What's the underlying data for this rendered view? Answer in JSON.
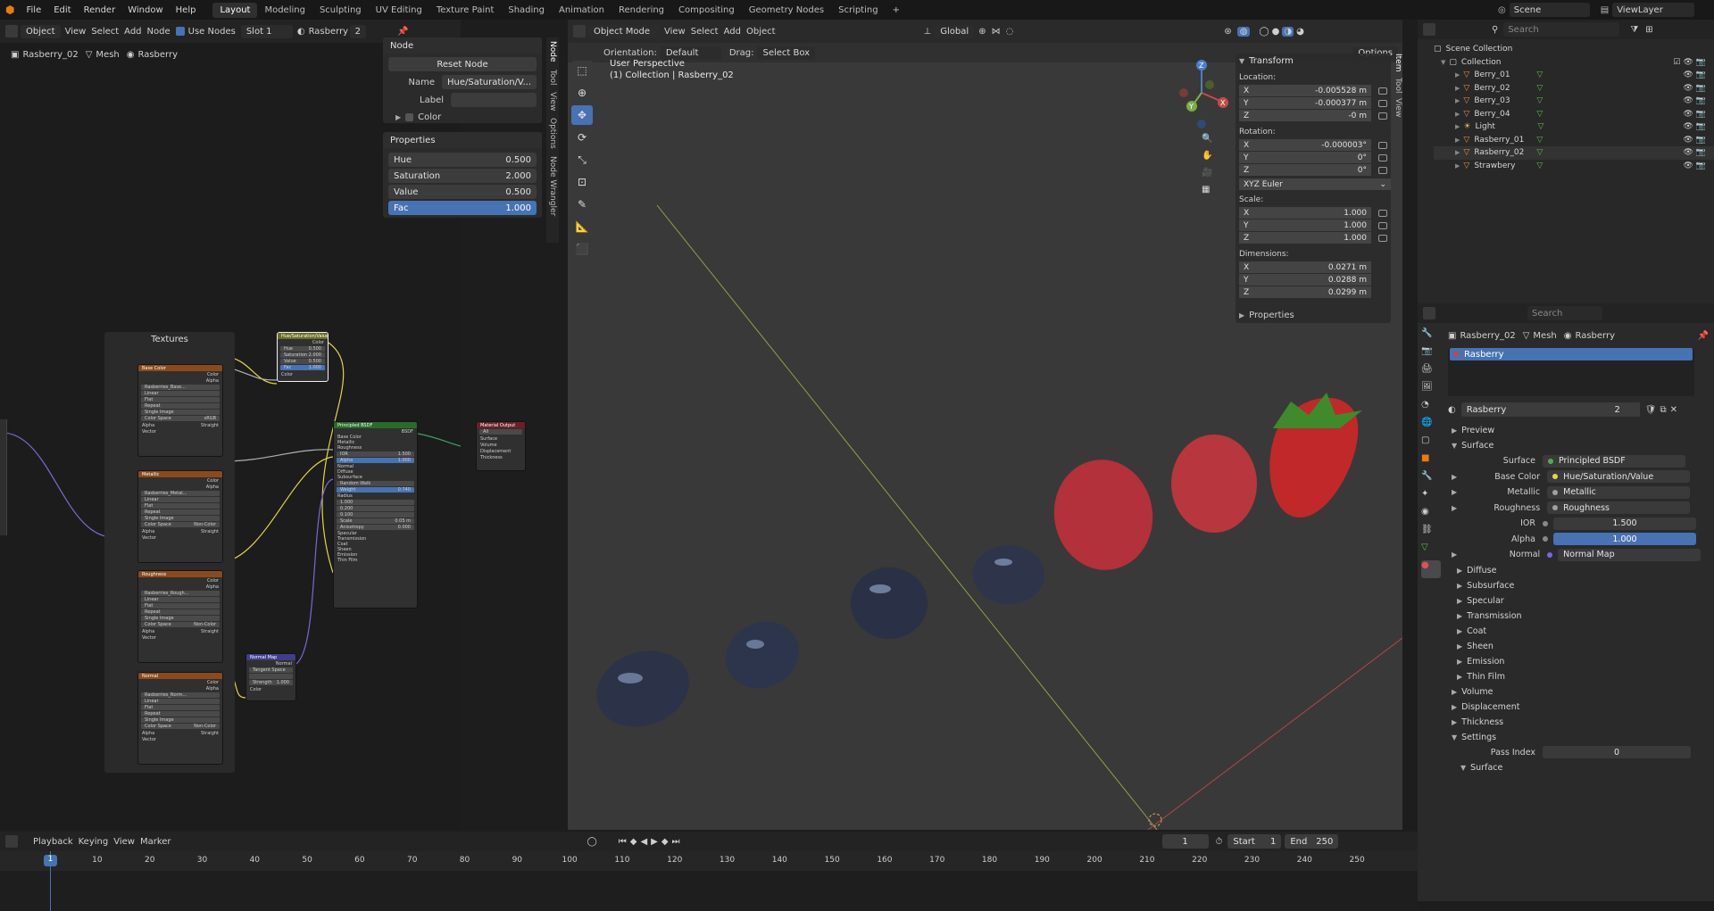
{
  "topbar": {
    "menus": [
      "File",
      "Edit",
      "Render",
      "Window",
      "Help"
    ],
    "workspaces": [
      "Layout",
      "Modeling",
      "Sculpting",
      "UV Editing",
      "Texture Paint",
      "Shading",
      "Animation",
      "Rendering",
      "Compositing",
      "Geometry Nodes",
      "Scripting",
      "+"
    ],
    "active_workspace": "Layout",
    "scene": "Scene",
    "view_layer": "ViewLayer"
  },
  "node_editor": {
    "header": {
      "mode": "Object",
      "view": "View",
      "select": "Select",
      "add": "Add",
      "node": "Node",
      "use_nodes": "Use Nodes",
      "slot": "Slot 1",
      "material": "Rasberry",
      "users": "2"
    },
    "breadcrumb": [
      "Rasberry_02",
      "Mesh",
      "Rasberry"
    ],
    "frame_label": "Textures",
    "side_tabs": [
      "Node",
      "Tool",
      "View",
      "Options",
      "Node Wrangler"
    ],
    "node_panel": {
      "title": "Node",
      "reset": "Reset Node",
      "name_label": "Name",
      "name_value": "Hue/Saturation/V...",
      "label_label": "Label",
      "color_label": "Color"
    },
    "properties_panel": {
      "title": "Properties",
      "rows": [
        {
          "label": "Hue",
          "value": "0.500"
        },
        {
          "label": "Saturation",
          "value": "2.000"
        },
        {
          "label": "Value",
          "value": "0.500"
        },
        {
          "label": "Fac",
          "value": "1.000"
        }
      ]
    },
    "nodes": {
      "base_color": {
        "title": "Base Color",
        "image": "Rasberries_Base...",
        "rows": [
          "Linear",
          "Flat",
          "Repeat",
          "Single Image"
        ],
        "cs_label": "Color Space",
        "cs_value": "sRGB",
        "alpha_label": "Alpha",
        "alpha_value": "Straight",
        "out1": "Color",
        "out2": "Alpha",
        "vec": "Vector"
      },
      "metallic": {
        "title": "Metallic",
        "image": "Rasberries_Metal...",
        "rows": [
          "Linear",
          "Flat",
          "Repeat",
          "Single Image"
        ],
        "cs_label": "Color Space",
        "cs_value": "Non-Color",
        "alpha_label": "Alpha",
        "alpha_value": "Straight",
        "out1": "Color",
        "out2": "Alpha",
        "vec": "Vector"
      },
      "roughness": {
        "title": "Roughness",
        "image": "Rasberries_Rough...",
        "rows": [
          "Linear",
          "Flat",
          "Repeat",
          "Single Image"
        ],
        "cs_label": "Color Space",
        "cs_value": "Non-Color",
        "alpha_label": "Alpha",
        "alpha_value": "Straight",
        "out1": "Color",
        "out2": "Alpha",
        "vec": "Vector"
      },
      "normal": {
        "title": "Normal",
        "image": "Rasberries_Norm...",
        "rows": [
          "Linear",
          "Flat",
          "Repeat",
          "Single Image"
        ],
        "cs_label": "Color Space",
        "cs_value": "Non-Color",
        "alpha_label": "Alpha",
        "alpha_value": "Straight",
        "out1": "Color",
        "out2": "Alpha",
        "vec": "Vector"
      },
      "hsv": {
        "title": "Hue/Saturation/Value",
        "rows": [
          {
            "l": "Hue",
            "v": "0.500"
          },
          {
            "l": "Saturation",
            "v": "2.000"
          },
          {
            "l": "Value",
            "v": "0.500"
          },
          {
            "l": "Fac",
            "v": "1.000"
          }
        ],
        "out": "Color",
        "inp": "Color"
      },
      "normal_map": {
        "title": "Normal Map",
        "out": "Normal",
        "space": "Tangent Space",
        "strength_label": "Strength",
        "strength": "1.000",
        "inp": "Color"
      },
      "bsdf": {
        "title": "Principled BSDF",
        "out": "BSDF",
        "rows": [
          "Base Color",
          "Metallic",
          "Roughness",
          "IOR",
          "Alpha",
          "Normal",
          "Diffuse",
          "Subsurface",
          "Random Walk",
          "Weight",
          "Radius",
          "1.000",
          "0.200",
          "0.100",
          "Scale",
          "Anisotropy",
          "Specular",
          "Transmission",
          "Coat",
          "Sheen",
          "Emission",
          "Thin Film"
        ],
        "ior": "1.500",
        "alpha": "1.000",
        "weight": "0.740",
        "scale": "0.05 m",
        "aniso": "0.000"
      },
      "output": {
        "title": "Material Output",
        "target": "All",
        "rows": [
          "Surface",
          "Volume",
          "Displacement",
          "Thickness"
        ]
      }
    }
  },
  "viewport": {
    "header": {
      "mode": "Object Mode",
      "view": "View",
      "select": "Select",
      "add": "Add",
      "object": "Object",
      "transform": "Global"
    },
    "sub": {
      "orientation_label": "Orientation:",
      "orientation": "Default",
      "drag_label": "Drag:",
      "drag": "Select Box",
      "options": "Options"
    },
    "overlay_title": "User Perspective",
    "overlay_sub": "(1) Collection | Rasberry_02",
    "side_tabs": [
      "Item",
      "Tool",
      "View"
    ],
    "transform": {
      "title": "Transform",
      "location_label": "Location:",
      "location": [
        {
          "a": "X",
          "v": "-0.005528 m"
        },
        {
          "a": "Y",
          "v": "-0.000377 m"
        },
        {
          "a": "Z",
          "v": "-0 m"
        }
      ],
      "rotation_label": "Rotation:",
      "rotation": [
        {
          "a": "X",
          "v": "-0.000003°"
        },
        {
          "a": "Y",
          "v": "0°"
        },
        {
          "a": "Z",
          "v": "0°"
        }
      ],
      "rotation_mode": "XYZ Euler",
      "scale_label": "Scale:",
      "scale": [
        {
          "a": "X",
          "v": "1.000"
        },
        {
          "a": "Y",
          "v": "1.000"
        },
        {
          "a": "Z",
          "v": "1.000"
        }
      ],
      "dimensions_label": "Dimensions:",
      "dimensions": [
        {
          "a": "X",
          "v": "0.0271 m"
        },
        {
          "a": "Y",
          "v": "0.0288 m"
        },
        {
          "a": "Z",
          "v": "0.0299 m"
        }
      ],
      "properties": "Properties"
    },
    "gizmo": {
      "x": "X",
      "y": "Y",
      "z": "Z"
    }
  },
  "outliner": {
    "search_placeholder": "Search",
    "root": "Scene Collection",
    "collection": "Collection",
    "items": [
      "Berry_01",
      "Berry_02",
      "Berry_03",
      "Berry_04",
      "Light",
      "Rasberry_01",
      "Rasberry_02",
      "Strawbery"
    ]
  },
  "properties": {
    "search_placeholder": "Search",
    "breadcrumb": [
      "Rasberry_02",
      "Mesh",
      "Rasberry"
    ],
    "material_slot": "Rasberry",
    "material_name": "Rasberry",
    "users": "2",
    "preview": "Preview",
    "surface_section": "Surface",
    "rows": [
      {
        "label": "Surface",
        "value": "Principled BSDF",
        "dot": "#4caf50"
      },
      {
        "label": "Base Color",
        "value": "Hue/Saturation/Value",
        "dot": "#e5d34a"
      },
      {
        "label": "Metallic",
        "value": "Metallic",
        "dot": "#a0a0a0"
      },
      {
        "label": "Roughness",
        "value": "Roughness",
        "dot": "#a0a0a0"
      }
    ],
    "ior_label": "IOR",
    "ior": "1.500",
    "alpha_label": "Alpha",
    "alpha": "1.000",
    "normal_label": "Normal",
    "normal": "Normal Map",
    "sub_sections": [
      "Diffuse",
      "Subsurface",
      "Specular",
      "Transmission",
      "Coat",
      "Sheen",
      "Emission",
      "Thin Film"
    ],
    "volume": "Volume",
    "displacement": "Displacement",
    "thickness": "Thickness",
    "settings": "Settings",
    "pass_index_label": "Pass Index",
    "pass_index": "0",
    "settings_surface": "Surface"
  },
  "timeline": {
    "menus": [
      "Playback",
      "Keying",
      "View",
      "Marker"
    ],
    "current_frame": "1",
    "start_label": "Start",
    "start": "1",
    "end_label": "End",
    "end": "250",
    "ticks": [
      "1",
      "10",
      "20",
      "30",
      "40",
      "50",
      "60",
      "70",
      "80",
      "90",
      "100",
      "110",
      "120",
      "130",
      "140",
      "150",
      "160",
      "170",
      "180",
      "190",
      "200",
      "210",
      "220",
      "230",
      "240",
      "250"
    ]
  },
  "colors": {
    "accent": "#4772b3",
    "header": "#232323",
    "viewport_bg": "#393939",
    "texture_node": "#8a4a1c",
    "bsdf_node": "#2b7c2b",
    "output_node": "#7a1f2b",
    "hsv_node": "#c8c444",
    "normalmap_node": "#4a4a9a"
  }
}
